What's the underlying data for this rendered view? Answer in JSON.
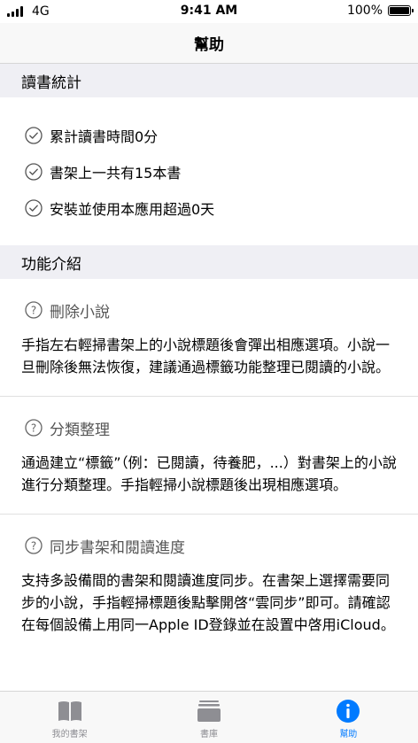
{
  "status_bar": {
    "network": "4G",
    "time": "9:41 AM",
    "battery": "100%"
  },
  "nav": {
    "title": "幫助"
  },
  "stats": {
    "header": "讀書統計",
    "items": [
      {
        "label": "累計讀書時間0分"
      },
      {
        "label": "書架上一共有15本書"
      },
      {
        "label": "安裝並使用本應用超過0天"
      }
    ]
  },
  "features": {
    "header": "功能介紹",
    "items": [
      {
        "title": "刪除小說",
        "body": "手指左右輕掃書架上的小說標題後會彈出相應選項。小說一旦刪除後無法恢復，建議通過標籤功能整理已閱讀的小說。"
      },
      {
        "title": "分類整理",
        "body": "通過建立“標籤”（例：已閱讀，待養肥，...）對書架上的小說進行分類整理。手指輕掃小說標題後出現相應選項。"
      },
      {
        "title": "同步書架和閱讀進度",
        "body": "支持多設備間的書架和閱讀進度同步。在書架上選擇需要同步的小說，手指輕掃標題後點擊開啓“雲同步”即可。請確認在每個設備上用同一Apple ID登錄並在設置中啓用iCloud。"
      }
    ]
  },
  "tabs": [
    {
      "label": "我的書架",
      "icon": "book-icon",
      "active": false
    },
    {
      "label": "書庫",
      "icon": "library-icon",
      "active": false
    },
    {
      "label": "幫助",
      "icon": "info-icon",
      "active": true
    }
  ],
  "colors": {
    "accent": "#007aff",
    "inactive": "#8e8e93",
    "section_bg": "#efeff4"
  }
}
